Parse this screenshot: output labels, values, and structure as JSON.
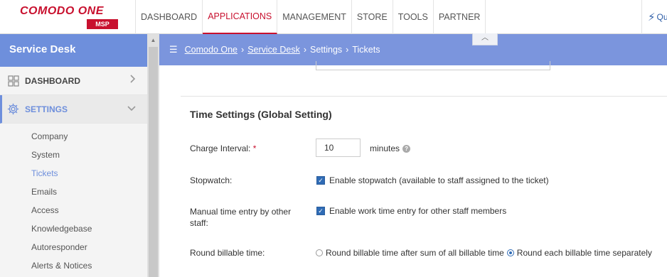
{
  "brand": {
    "name": "COMODO ONE",
    "badge": "MSP"
  },
  "nav": {
    "items": [
      "DASHBOARD",
      "APPLICATIONS",
      "MANAGEMENT",
      "STORE",
      "TOOLS",
      "PARTNER"
    ],
    "active": "APPLICATIONS",
    "quick_label": "Qu"
  },
  "sidebar": {
    "title": "Service Desk",
    "sections": [
      {
        "label": "DASHBOARD",
        "icon": "grid-icon",
        "chevron": "chevron-right-icon"
      },
      {
        "label": "SETTINGS",
        "icon": "gear-icon",
        "chevron": "chevron-down-icon"
      }
    ],
    "subitems": [
      "Company",
      "System",
      "Tickets",
      "Emails",
      "Access",
      "Knowledgebase",
      "Autoresponder",
      "Alerts & Notices"
    ],
    "active_subitem": "Tickets"
  },
  "breadcrumb": {
    "items": [
      "Comodo One",
      "Service Desk",
      "Settings",
      "Tickets"
    ]
  },
  "time_settings": {
    "title": "Time Settings (Global Setting)",
    "charge_interval": {
      "label": "Charge Interval:",
      "required": "*",
      "value": "10",
      "unit": "minutes"
    },
    "stopwatch": {
      "label": "Stopwatch:",
      "checkbox_label": "Enable stopwatch (available to staff assigned to the ticket)",
      "checked": true
    },
    "manual_entry": {
      "label_line1": "Manual time entry by other",
      "label_line2": "staff:",
      "checkbox_label": "Enable work time entry for other staff members",
      "checked": true
    },
    "round_billable": {
      "label": "Round billable time:",
      "options": [
        "Round billable time after sum of all billable time",
        "Round each billable time separately"
      ],
      "selected": "Round each billable time separately"
    }
  },
  "colors": {
    "accent": "#6e8fdc",
    "brand_red": "#c8102e",
    "checkbox_blue": "#2f6bb5"
  }
}
